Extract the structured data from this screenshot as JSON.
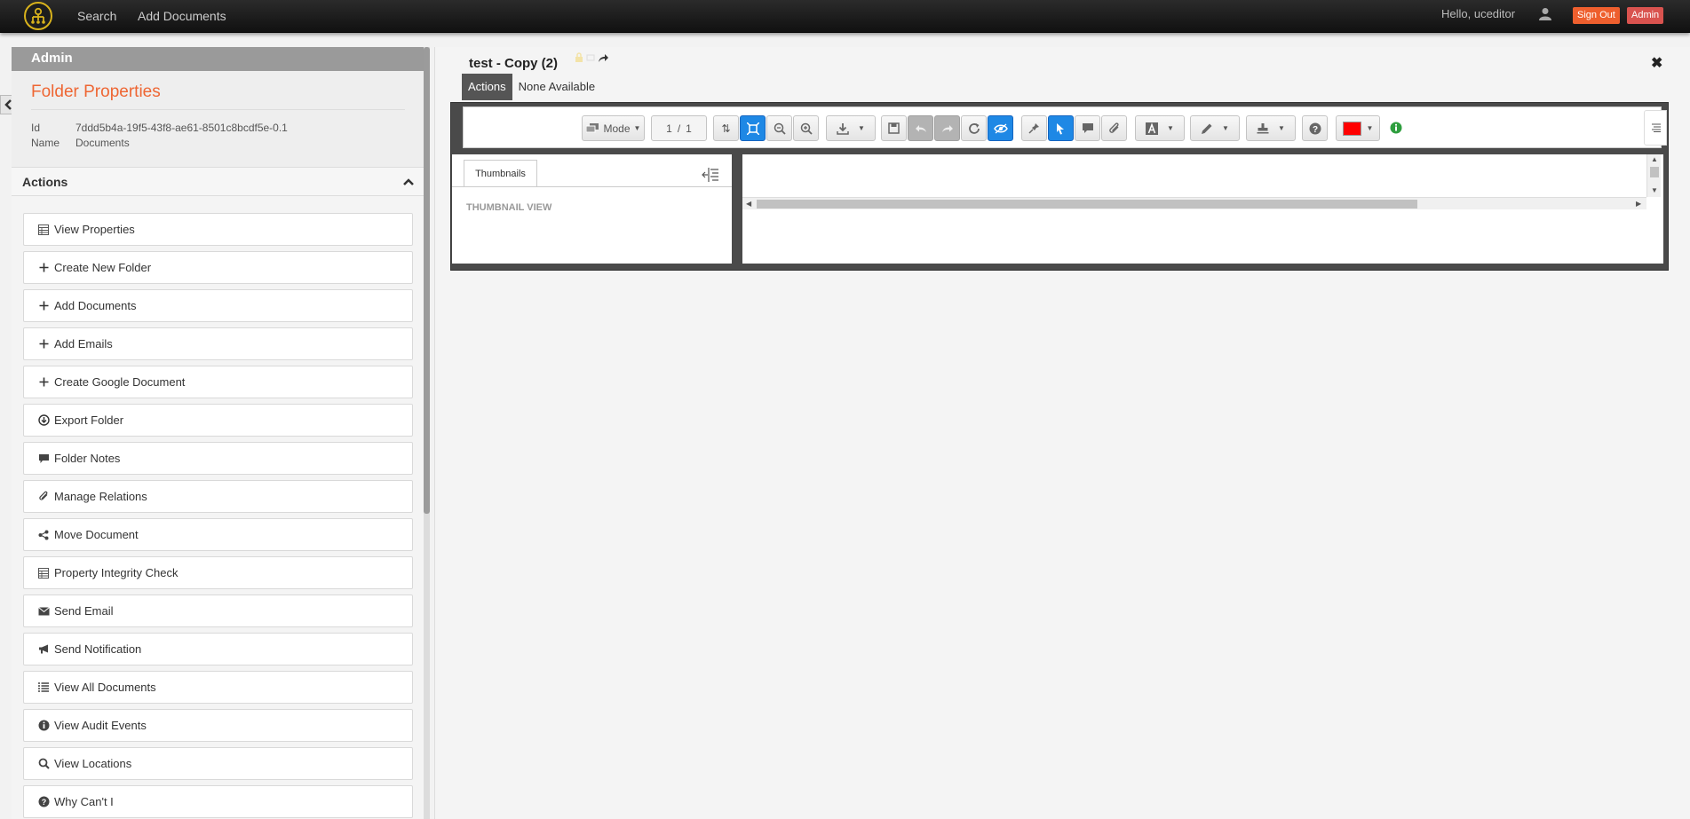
{
  "navbar": {
    "search_label": "Search",
    "add_documents_label": "Add Documents",
    "greeting": "Hello, uceditor",
    "signout_label": "Sign Out",
    "admin_label": "Admin",
    "logo_icon": "logo-icon",
    "user_icon": "user-icon"
  },
  "sidebar": {
    "admin_title": "Admin",
    "folder_props_title": "Folder Properties",
    "id_label": "Id",
    "id_value": "7ddd5b4a-19f5-43f8-ae61-8501c8bcdf5e-0.1",
    "name_label": "Name",
    "name_value": "Documents",
    "actions_title": "Actions",
    "actions": [
      {
        "label": "View Properties",
        "icon": "table-icon"
      },
      {
        "label": "Create New Folder",
        "icon": "plus-icon"
      },
      {
        "label": "Add Documents",
        "icon": "plus-icon"
      },
      {
        "label": "Add Emails",
        "icon": "plus-icon"
      },
      {
        "label": "Create Google Document",
        "icon": "plus-icon"
      },
      {
        "label": "Export Folder",
        "icon": "download-circle-icon"
      },
      {
        "label": "Folder Notes",
        "icon": "comment-icon"
      },
      {
        "label": "Manage Relations",
        "icon": "paperclip-icon"
      },
      {
        "label": "Move Document",
        "icon": "share-icon"
      },
      {
        "label": "Property Integrity Check",
        "icon": "table-icon"
      },
      {
        "label": "Send Email",
        "icon": "envelope-icon"
      },
      {
        "label": "Send Notification",
        "icon": "bullhorn-icon"
      },
      {
        "label": "View All Documents",
        "icon": "list-icon"
      },
      {
        "label": "View Audit Events",
        "icon": "info-circle-icon"
      },
      {
        "label": "View Locations",
        "icon": "search-icon"
      },
      {
        "label": "Why Can't I",
        "icon": "question-circle-icon"
      }
    ]
  },
  "main": {
    "doc_title": "test - Copy (2)",
    "tabs": [
      {
        "label": "Actions",
        "active": true
      },
      {
        "label": "None Available",
        "active": false
      }
    ],
    "viewer": {
      "mode_label": "Mode",
      "page_current": "1",
      "page_separator": "/",
      "page_total": "1",
      "thumbnails_tab": "Thumbnails",
      "thumbnail_view_label": "THUMBNAIL VIEW",
      "annotation_color": "#ff0000"
    }
  }
}
